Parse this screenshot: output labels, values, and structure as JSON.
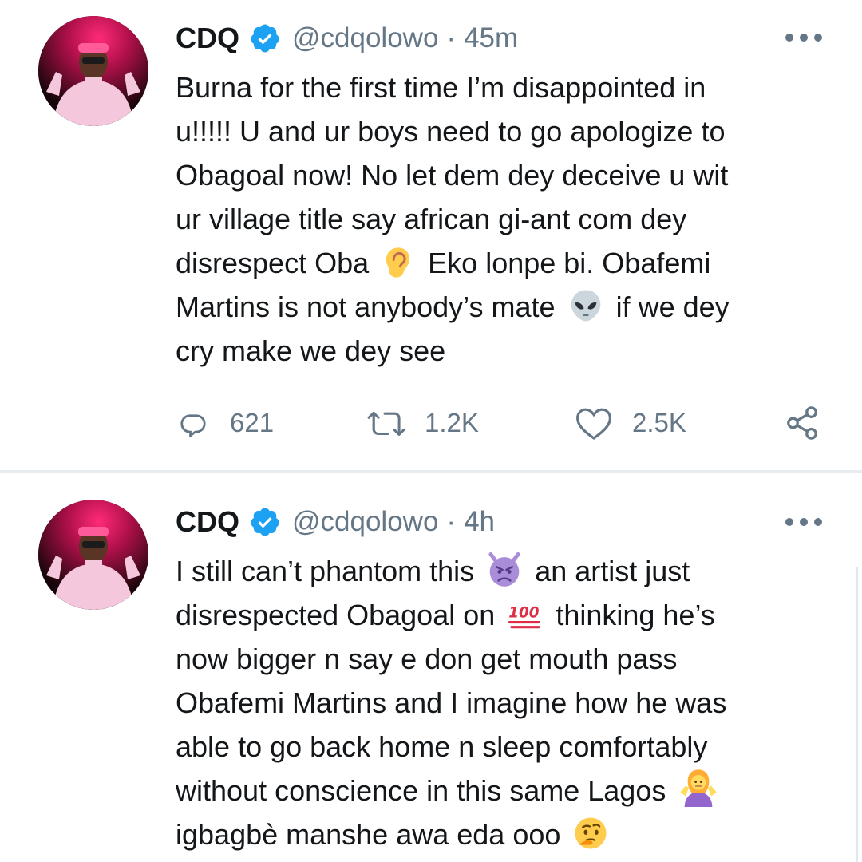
{
  "tweets": [
    {
      "name": "CDQ",
      "handle": "@cdqolowo",
      "separator": "·",
      "time": "45m",
      "lines": [
        [
          "Burna for the first time I’m disappointed in"
        ],
        [
          "u!!!!! U and ur boys need to go apologize to"
        ],
        [
          "Obagoal now! No let dem dey deceive u wit"
        ],
        [
          "ur village title say african gi-ant com dey"
        ],
        [
          "disrespect Oba",
          "Eko lonpe bi. Obafemi"
        ],
        [
          "Martins is not anybody’s mate",
          "if we dey"
        ],
        [
          "cry make we dey see"
        ]
      ],
      "emojis": [
        "ear-emoji",
        "alien-emoji"
      ],
      "stats": {
        "replies": "621",
        "retweets": "1.2K",
        "likes": "2.5K"
      }
    },
    {
      "name": "CDQ",
      "handle": "@cdqolowo",
      "separator": "·",
      "time": "4h",
      "lines": [
        [
          "I still can’t phantom this",
          "an artist just"
        ],
        [
          "disrespected Obagoal on",
          "thinking he’s"
        ],
        [
          "now bigger n say e don get mouth pass"
        ],
        [
          "Obafemi Martins and I imagine how he was"
        ],
        [
          "able to go back home n sleep comfortably"
        ],
        [
          "without conscience in this same Lagos"
        ],
        [
          "igbagbè manshe awa eda ooo"
        ]
      ],
      "emojis": [
        "angry-devil-emoji",
        "hundred-points-emoji",
        "shrug-emoji",
        "thinking-face-emoji"
      ]
    }
  ],
  "colors": {
    "text": "#14171a",
    "secondary": "#657786",
    "verified": "#1da1f2",
    "divider": "#e6ecf0"
  },
  "icons": [
    "reply-icon",
    "retweet-icon",
    "like-icon",
    "share-icon",
    "verified-badge-icon",
    "more-options-icon"
  ]
}
